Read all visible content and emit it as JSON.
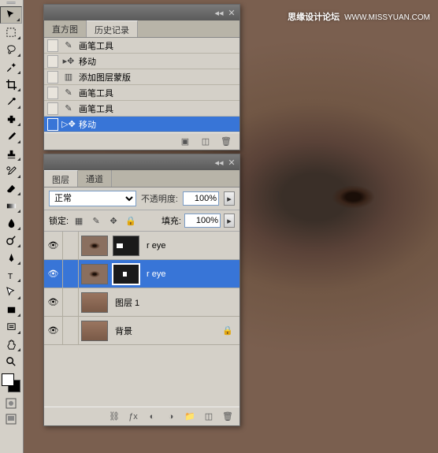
{
  "watermark": {
    "text": "思缘设计论坛",
    "url": "WWW.MISSYUAN.COM"
  },
  "history_panel": {
    "tabs": [
      {
        "label": "直方图"
      },
      {
        "label": "历史记录"
      }
    ],
    "active_tab": 1,
    "items": [
      {
        "icon": "brush",
        "label": "画笔工具"
      },
      {
        "icon": "move",
        "label": "移动"
      },
      {
        "icon": "mask",
        "label": "添加图层蒙版"
      },
      {
        "icon": "brush",
        "label": "画笔工具"
      },
      {
        "icon": "brush",
        "label": "画笔工具"
      },
      {
        "icon": "move",
        "label": "移动",
        "selected": true
      }
    ]
  },
  "layers_panel": {
    "tabs": [
      {
        "label": "图层"
      },
      {
        "label": "通道"
      }
    ],
    "active_tab": 0,
    "blend_mode": "正常",
    "opacity_label": "不透明度:",
    "opacity_value": "100%",
    "lock_label": "锁定:",
    "fill_label": "填充:",
    "fill_value": "100%",
    "layers": [
      {
        "name": "r eye",
        "mask": "m1",
        "thumb": "eye-img"
      },
      {
        "name": "r eye",
        "mask": "m2",
        "thumb": "eye-img",
        "selected": true
      },
      {
        "name": "图层 1",
        "thumb": "face"
      },
      {
        "name": "背景",
        "thumb": "face",
        "locked": true
      }
    ]
  }
}
